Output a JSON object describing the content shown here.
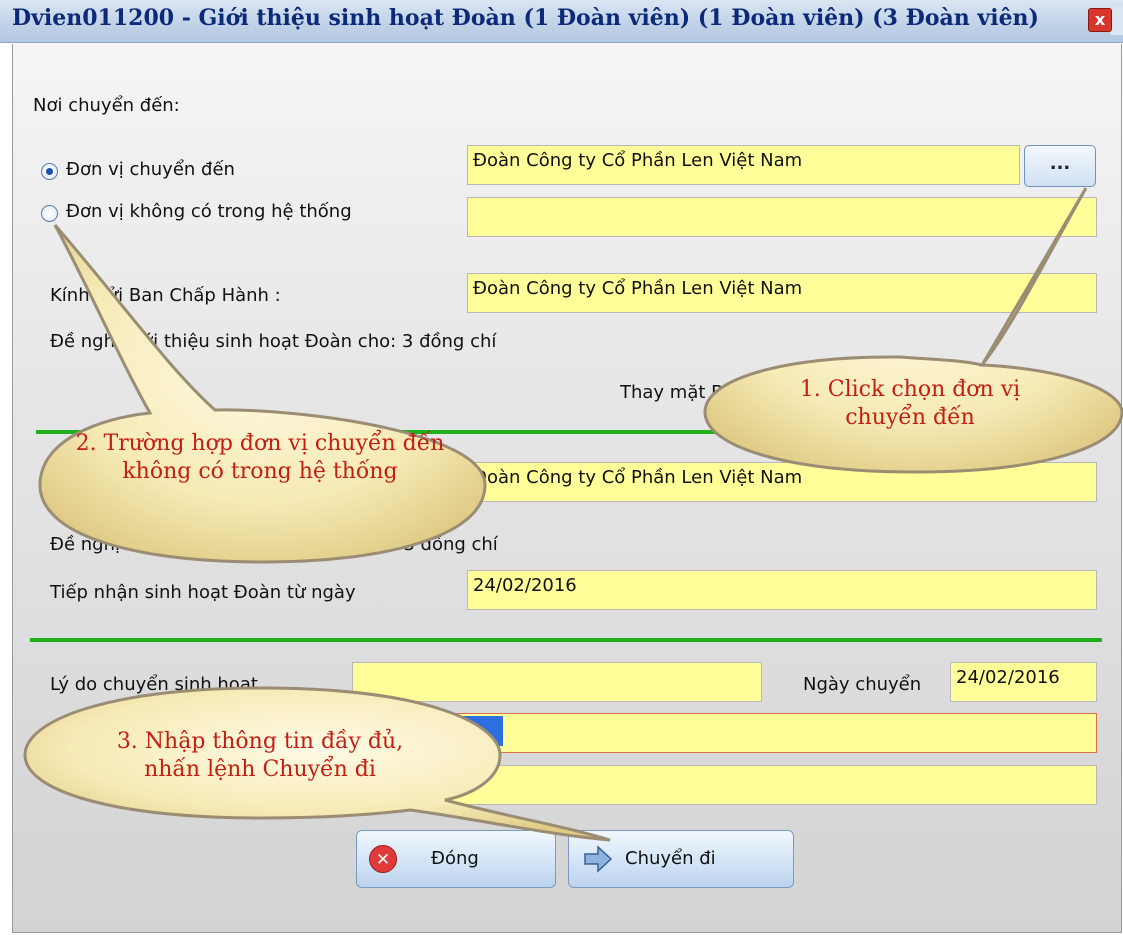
{
  "window": {
    "title": "Dvien011200 - Giới thiệu sinh hoạt Đoàn (1 Đoàn viên) (1 Đoàn viên) (3 Đoàn viên)",
    "close_label": "x"
  },
  "form": {
    "section_label": "Nơi chuyển đến:",
    "radio_in_system": "Đơn vị chuyển đến",
    "radio_not_in_system": "Đơn vị không có trong hệ thống",
    "unit_value": "Đoàn Công ty Cổ Phần Len Việt Nam",
    "unit_not_in_system_value": "",
    "browse_label": "...",
    "recipient_label": "Kính gửi Ban Chấp Hành :",
    "recipient_value": "Đoàn Công ty Cổ Phần Len Việt Nam",
    "proposal_text": "Đề nghị giới thiệu sinh hoạt Đoàn cho: 3 đồng chí",
    "on_behalf_text": "Thay mặt BCH",
    "unit2_value": "Đoàn Công ty Cổ Phần Len Việt Nam",
    "proposal2_text": "Đề nghị tiếp nhận sinh hoạt Đoàn cho: 3 đồng chí",
    "receive_label": "Tiếp nhận sinh hoạt Đoàn từ ngày",
    "receive_date": "24/02/2016",
    "reason_label": "Lý do chuyển sinh hoạt",
    "reason_value": "",
    "transfer_date_label": "Ngày chuyển",
    "transfer_date": "24/02/2016",
    "selected_text": "TN",
    "note_value": ""
  },
  "buttons": {
    "close": "Đóng",
    "transfer": "Chuyển đi"
  },
  "callouts": {
    "c1": "1. Click chọn đơn vị chuyển đến",
    "c2": "2. Trường hợp đơn vị chuyển đến không có trong hệ thống",
    "c3": "3. Nhập thông tin đầy đủ, nhấn lệnh Chuyển đi"
  },
  "colors": {
    "field_bg": "#fffe99",
    "divider": "#1db21d",
    "callout_text": "#c41e12",
    "title_text": "#0c2a79"
  }
}
